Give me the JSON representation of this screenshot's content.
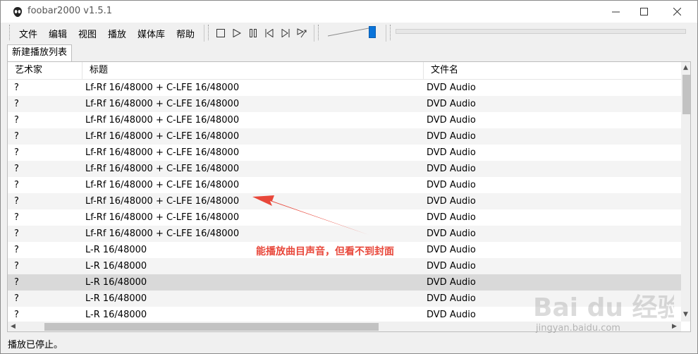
{
  "window": {
    "title": "foobar2000 v1.5.1"
  },
  "menu": [
    "文件",
    "编辑",
    "视图",
    "播放",
    "媒体库",
    "帮助"
  ],
  "toolbar_icons": [
    "stop-icon",
    "play-icon",
    "pause-icon",
    "previous-icon",
    "next-icon",
    "random-icon"
  ],
  "playlist_tab": "新建播放列表",
  "columns": {
    "artist": "艺术家",
    "title": "标题",
    "filename": "文件名"
  },
  "rows": [
    {
      "artist": "?",
      "title": "Lf-Rf 16/48000 + C-LFE 16/48000",
      "filename": "DVD Audio"
    },
    {
      "artist": "?",
      "title": "Lf-Rf 16/48000 + C-LFE 16/48000",
      "filename": "DVD Audio"
    },
    {
      "artist": "?",
      "title": "Lf-Rf 16/48000 + C-LFE 16/48000",
      "filename": "DVD Audio"
    },
    {
      "artist": "?",
      "title": "Lf-Rf 16/48000 + C-LFE 16/48000",
      "filename": "DVD Audio"
    },
    {
      "artist": "?",
      "title": "Lf-Rf 16/48000 + C-LFE 16/48000",
      "filename": "DVD Audio"
    },
    {
      "artist": "?",
      "title": "Lf-Rf 16/48000 + C-LFE 16/48000",
      "filename": "DVD Audio"
    },
    {
      "artist": "?",
      "title": "Lf-Rf 16/48000 + C-LFE 16/48000",
      "filename": "DVD Audio"
    },
    {
      "artist": "?",
      "title": "Lf-Rf 16/48000 + C-LFE 16/48000",
      "filename": "DVD Audio"
    },
    {
      "artist": "?",
      "title": "Lf-Rf 16/48000 + C-LFE 16/48000",
      "filename": "DVD Audio"
    },
    {
      "artist": "?",
      "title": "Lf-Rf 16/48000 + C-LFE 16/48000",
      "filename": "DVD Audio"
    },
    {
      "artist": "?",
      "title": "L-R 16/48000",
      "filename": "DVD Audio"
    },
    {
      "artist": "?",
      "title": "L-R 16/48000",
      "filename": "DVD Audio"
    },
    {
      "artist": "?",
      "title": "L-R 16/48000",
      "filename": "DVD Audio"
    },
    {
      "artist": "?",
      "title": "L-R 16/48000",
      "filename": "DVD Audio"
    },
    {
      "artist": "?",
      "title": "L-R 16/48000",
      "filename": "DVD Audio"
    }
  ],
  "status": "播放已停止。",
  "annotation": "能播放曲目声音，但看不到封面",
  "watermark": {
    "text": "Bai du 经验",
    "sub": "jingyan.baidu.com"
  },
  "colors": {
    "accent": "#0a74da",
    "annotation": "#e8473a",
    "selected_row": "#d9d9d9"
  }
}
